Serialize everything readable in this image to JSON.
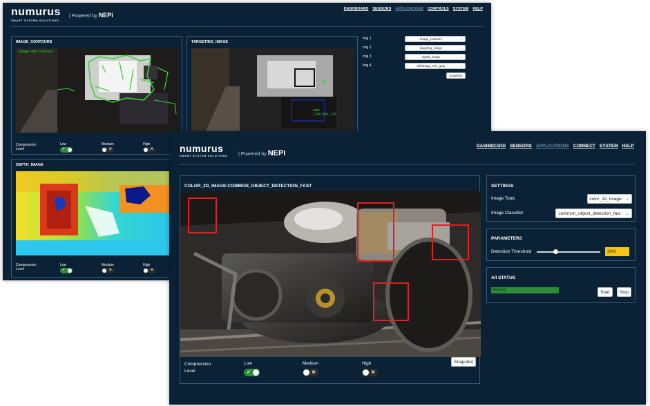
{
  "back_window": {
    "logo": "numurus",
    "logo_sub": "SMART SYSTEM SOLUTIONS",
    "powered_by": "| Powered by",
    "powered_brand": "NEPi",
    "nav": [
      "DASHBOARD",
      "SENSORS",
      "APPLICATIONS",
      "CONTROLS",
      "SYSTEM",
      "HELP"
    ],
    "active_nav": "APPLICATIONS",
    "panels": {
      "contours_title": "IMAGE_CONTOURS",
      "contours_overlay": "Image with Contours",
      "targeting_title": "TARGETING_IMAGE",
      "targeting_overlay_1": "auto",
      "targeting_overlay_2": "1.3m.16m,-17d",
      "depth_title": "DEPTH_IMAGE"
    },
    "compression": {
      "label_1": "Compression",
      "label_2": "Level",
      "low": "Low",
      "medium": "Medium",
      "high": "High"
    },
    "img_selectors": [
      {
        "label": "Img 1",
        "value": "image_contours"
      },
      {
        "label": "Img 2",
        "value": "targeting_image"
      },
      {
        "label": "Img 3",
        "value": "depth_image"
      },
      {
        "label": "Img 4",
        "value": "left/image_rect_gray"
      }
    ],
    "snapshot": "Snapshot"
  },
  "front_window": {
    "logo": "numurus",
    "logo_sub": "SMART SYSTEM SOLUTIONS",
    "powered_by": "| Powered by",
    "powered_brand": "NEPi",
    "nav": [
      "DASHBOARD",
      "SENSORS",
      "APPLICATIONS",
      "CONNECT",
      "SYSTEM",
      "HELP"
    ],
    "active_nav": "APPLICATIONS",
    "image_title": "COLOR_2D_IMAGE:COMMON_OBJECT_DETECTION_FAST",
    "compression": {
      "label_1": "Compression",
      "label_2": "Level",
      "low": "Low",
      "medium": "Medium",
      "high": "High"
    },
    "snapshot": "Snapshot",
    "settings": {
      "title": "SETTINGS",
      "topic_label": "Image Topic",
      "topic_value": "color_2d_image",
      "classifier_label": "Image Classifier",
      "classifier_value": "common_object_detection_fast"
    },
    "parameters": {
      "title": "PARAMETERS",
      "threshold_label": "Detection Threshold",
      "threshold_value": "30%",
      "threshold_fraction": 0.3
    },
    "ai_status": {
      "title": "A/I STATUS",
      "status": "Running",
      "start": "Start",
      "stop": "Stop"
    }
  },
  "colors": {
    "background": "#0b2236",
    "accent_green": "#2e8b3a",
    "threshold_yellow": "#f5c518",
    "detection_red": "#e02020"
  }
}
